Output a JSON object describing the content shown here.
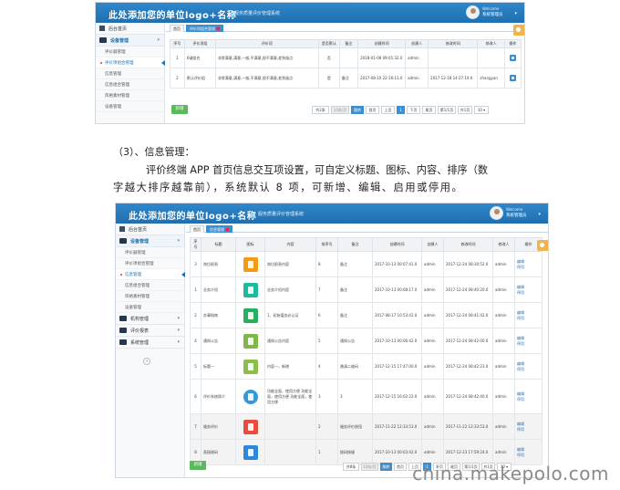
{
  "screen1": {
    "logo": "此处添加您的单位logo+名称",
    "system_name": "服务质量评价管理系统",
    "welcome": "Welcome",
    "user": "系统管理员",
    "sidebar": {
      "home": "后台首页",
      "group": "设备管理",
      "items": [
        "评价器管理",
        "评价项组合管理",
        "信息管理",
        "信息组合管理",
        "风格素材管理",
        "设备管理"
      ]
    },
    "tabs": [
      "首页",
      "评价项组合管理"
    ],
    "columns": [
      "序号",
      "评价项组",
      "评价项",
      "是否默认",
      "备注",
      "创建时间",
      "创建人",
      "修改时间",
      "修改人",
      "操作"
    ],
    "rows": [
      [
        "1",
        "6键组合",
        "非常满意,满意,一般,不满意,很不满意,差到极点",
        "否",
        "",
        "2018-01-08 09:01:32.0",
        "admin",
        "",
        "",
        ""
      ],
      [
        "2",
        "默认评价组",
        "非常满意,满意,一般,不满意,很不满意,差到极点",
        "是",
        "备注",
        "2017-08-10 22:16:13.0",
        "admin",
        "2017-12-18 14:27:19.0",
        "zhangyan",
        ""
      ]
    ],
    "add_label": "新增",
    "pager": {
      "total": "共2条",
      "per_page": "10条/页",
      "go": "跳转",
      "first": "首页",
      "prev": "上页",
      "current": "1",
      "next": "下页",
      "last": "尾页",
      "page_of": "第1/1页",
      "total_pages": "共1页",
      "size": "10"
    }
  },
  "section": {
    "heading": "（3）、信息管理：",
    "para_line1": "评价终端 APP 首页信息交互项设置，可自定义标题、图标、内容、排序（数",
    "para_line2": "字越大排序越靠前），系统默认 8 项，可新增、编辑、启用或停用。"
  },
  "screen2": {
    "logo": "此处添加您的单位logo+名称",
    "system_name": "服务质量评价管理系统",
    "welcome": "Welcome",
    "user": "系统管理员",
    "sidebar": {
      "home": "后台首页",
      "group": "设备管理",
      "items": [
        "评价器管理",
        "评价项组合管理",
        "信息管理",
        "信息组合管理",
        "风格素材管理",
        "设备管理"
      ],
      "groups": [
        "机构管理",
        "评价报表",
        "系统管理"
      ]
    },
    "tabs": [
      "首页",
      "信息管理"
    ],
    "columns": [
      "序号",
      "标题",
      "图标",
      "内容",
      "排序号",
      "备注",
      "创建时间",
      "创建人",
      "修改时间",
      "修改人",
      "操作"
    ],
    "rows": [
      {
        "no": "3",
        "title": "岗位职责",
        "content": "岗位职责内容",
        "order": "8",
        "note": "备注",
        "created": "2017-10-13 00:07:41.0",
        "creator": "admin",
        "modified": "2017-12-24 08:30:52.0",
        "modifier": "admin",
        "color": "#f39c12",
        "circle": false,
        "alt": false
      },
      {
        "no": "1",
        "title": "业务介绍",
        "content": "业务介绍内容",
        "order": "7",
        "note": "备注",
        "created": "2017-10-13 00:08:17.0",
        "creator": "admin",
        "modified": "2017-12-24 08:40:20.0",
        "modifier": "admin",
        "color": "#1abc9c",
        "circle": false,
        "alt": false
      },
      {
        "no": "2",
        "title": "办事指南",
        "content": "1、初始值务必认证",
        "order": "6",
        "note": "备注",
        "created": "2017-08-17 10:53:42.0",
        "creator": "admin",
        "modified": "2017-12-24 08:41:42.0",
        "modifier": "admin",
        "color": "#27ae60",
        "circle": false,
        "alt": false
      },
      {
        "no": "4",
        "title": "通知公告",
        "content": "通知公告内容",
        "order": "5",
        "note": "通知公告",
        "created": "2017-10-13 00:06:42.0",
        "creator": "admin",
        "modified": "2017-12-24 08:42:00.0",
        "modifier": "admin",
        "color": "#7fb74a",
        "circle": false,
        "alt": false
      },
      {
        "no": "5",
        "title": "标题一",
        "content": "内容一，新增",
        "order": "4",
        "note": "邀请二维码",
        "created": "2017-12-15 17:47:00.0",
        "creator": "admin",
        "modified": "2017-12-24 08:42:23.0",
        "modifier": "admin",
        "color": "#8bbf4a",
        "circle": false,
        "alt": false
      },
      {
        "no": "6",
        "title": "评价系统简介",
        "content": "功能全面，使用方便 功能全面，使用方便 功能全面，使用方便",
        "order": "3",
        "note": "3",
        "created": "2017-12-15 16:02:22.0",
        "creator": "admin",
        "modified": "2017-12-24 08:42:40.0",
        "modifier": "admin",
        "color": "#3498db",
        "circle": true,
        "alt": false
      },
      {
        "no": "7",
        "title": "服务评价",
        "content": "",
        "order": "2",
        "note": "服务评价按钮",
        "created": "2017-11-22 12:33:53.0",
        "creator": "admin",
        "modified": "2017-11-22 12:33:53.0",
        "modifier": "admin",
        "color": "#e74c3c",
        "circle": false,
        "alt": true
      },
      {
        "no": "8",
        "title": "直接拨码",
        "content": "",
        "order": "1",
        "note": "拨码按键",
        "created": "2017-10-13 00:03:42.0",
        "creator": "admin",
        "modified": "2017-12-23 17:59:24.0",
        "modifier": "admin",
        "color": "#2e86de",
        "circle": false,
        "alt": true
      }
    ],
    "op_edit": "编辑",
    "op_disable": "停用",
    "add_label": "新增",
    "pager": {
      "total": "共8条",
      "per_page": "10条/页",
      "go": "跳转",
      "first": "首页",
      "prev": "上页",
      "current": "1",
      "next": "下页",
      "last": "尾页",
      "page_of": "第1/1页",
      "total_pages": "共1页",
      "size": "10"
    }
  },
  "watermark": "china.makepolo.com"
}
